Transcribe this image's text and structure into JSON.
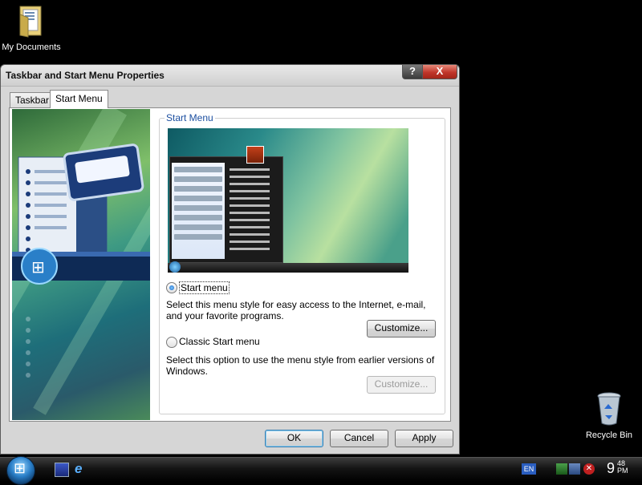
{
  "desktop": {
    "my_documents_label": "My Documents",
    "recycle_bin_label": "Recycle Bin"
  },
  "dialog": {
    "title": "Taskbar and Start Menu Properties",
    "help_label": "?",
    "close_label": "X",
    "tabs": [
      {
        "label": "Taskbar",
        "selected": false
      },
      {
        "label": "Start Menu",
        "selected": true
      }
    ],
    "group_label": "Start Menu",
    "option_start": {
      "label": "Start menu",
      "checked": true,
      "description": "Select this menu style for easy access to the Internet, e-mail, and your favorite programs.",
      "customize_label": "Customize..."
    },
    "option_classic": {
      "label": "Classic Start menu",
      "checked": false,
      "description": "Select this option to use the menu style from earlier versions of Windows.",
      "customize_label": "Customize..."
    },
    "buttons": {
      "ok": "OK",
      "cancel": "Cancel",
      "apply": "Apply"
    }
  },
  "taskbar": {
    "language": "EN",
    "clock_hour": "9",
    "clock_minute": "48",
    "clock_ampm": "PM"
  },
  "colors": {
    "group_label": "#1c4fa0",
    "close_button": "#c0352a",
    "taskbar": "#141414"
  }
}
